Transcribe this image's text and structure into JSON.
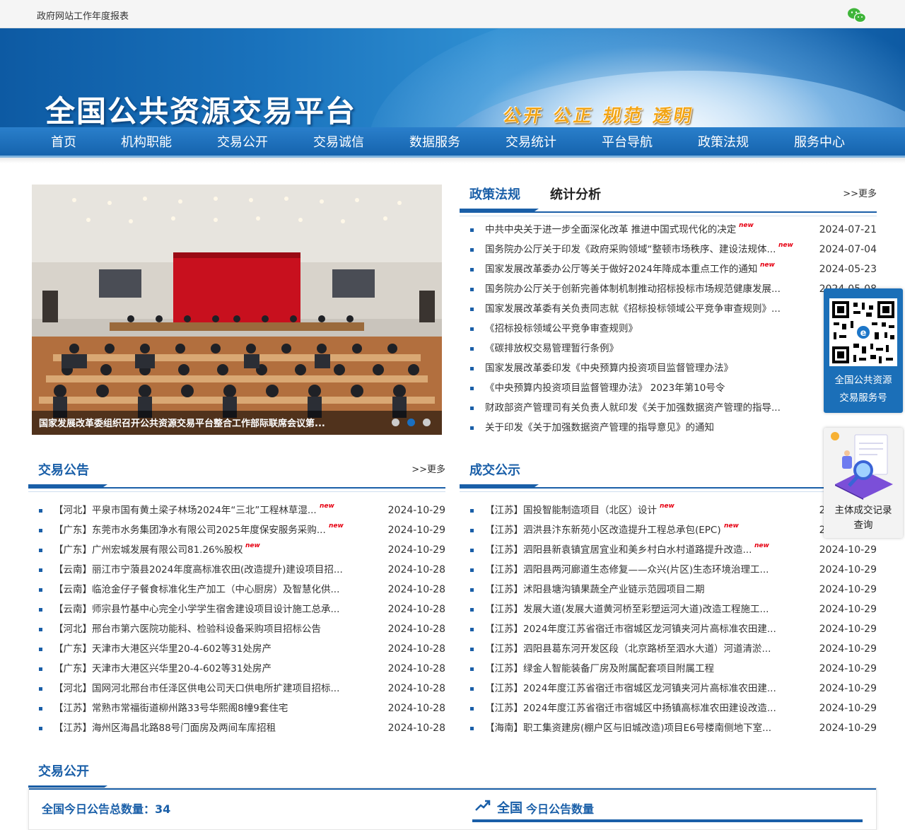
{
  "topbar": {
    "report_link": "政府网站工作年度报表",
    "wechat_icon": "wechat-icon"
  },
  "banner": {
    "title": "全国公共资源交易平台",
    "slogan": "公开 公正 规范 透明"
  },
  "nav": {
    "items": [
      "首页",
      "机构职能",
      "交易公开",
      "交易诚信",
      "数据服务",
      "交易统计",
      "平台导航",
      "政策法规",
      "服务中心"
    ]
  },
  "slider": {
    "caption": "国家发展改革委组织召开公共资源交易平台整合工作部际联席会议第...",
    "dots": 3,
    "active_dot": 2
  },
  "policy": {
    "tabs": [
      "政策法规",
      "统计分析"
    ],
    "more": ">>更多",
    "items": [
      {
        "title": "中共中央关于进一步全面深化改革 推进中国式现代化的决定",
        "date": "2024-07-21",
        "new": true
      },
      {
        "title": "国务院办公厅关于印发《政府采购领域“整顿市场秩序、建设法规体...",
        "date": "2024-07-04",
        "new": true
      },
      {
        "title": "国家发展改革委办公厅等关于做好2024年降成本重点工作的通知",
        "date": "2024-05-23",
        "new": true
      },
      {
        "title": "国务院办公厅关于创新完善体制机制推动招标投标市场规范健康发展...",
        "date": "2024-05-08",
        "new": false
      },
      {
        "title": "国家发展改革委有关负责同志就《招标投标领域公平竞争审查规则》...",
        "date": "",
        "new": false
      },
      {
        "title": "《招标投标领域公平竞争审查规则》",
        "date": "",
        "new": false
      },
      {
        "title": "《碳排放权交易管理暂行条例》",
        "date": "",
        "new": false
      },
      {
        "title": "国家发展改革委印发《中央预算内投资项目监督管理办法》",
        "date": "",
        "new": false
      },
      {
        "title": "《中央预算内投资项目监督管理办法》 2023年第10号令",
        "date": "",
        "new": false
      },
      {
        "title": "财政部资产管理司有关负责人就印发《关于加强数据资产管理的指导...",
        "date": "",
        "new": false
      },
      {
        "title": "关于印发《关于加强数据资产管理的指导意见》的通知",
        "date": "",
        "new": false
      }
    ]
  },
  "notice": {
    "title": "交易公告",
    "more": ">>更多",
    "items": [
      {
        "title": "【河北】平泉市国有黄土梁子林场2024年“三北”工程林草湿...",
        "date": "2024-10-29",
        "new": true
      },
      {
        "title": "【广东】东莞市水务集团净水有限公司2025年度保安服务采购...",
        "date": "2024-10-29",
        "new": true
      },
      {
        "title": "【广东】广州宏城发展有限公司81.26%股权",
        "date": "2024-10-29",
        "new": true
      },
      {
        "title": "【云南】丽江市宁蒗县2024年度高标准农田(改造提升)建设项目招...",
        "date": "2024-10-28",
        "new": false
      },
      {
        "title": "【云南】临沧金仔子餐食标准化生产加工（中心厨房）及智慧化供...",
        "date": "2024-10-28",
        "new": false
      },
      {
        "title": "【云南】师宗县竹基中心完全小学学生宿舍建设项目设计施工总承...",
        "date": "2024-10-28",
        "new": false
      },
      {
        "title": "【河北】邢台市第六医院功能科、检验科设备采购项目招标公告",
        "date": "2024-10-28",
        "new": false
      },
      {
        "title": "【广东】天津市大港区兴华里20-4-602等31处房产",
        "date": "2024-10-28",
        "new": false
      },
      {
        "title": "【广东】天津市大港区兴华里20-4-602等31处房产",
        "date": "2024-10-28",
        "new": false
      },
      {
        "title": "【河北】国网河北邢台市任泽区供电公司天口供电所扩建项目招标...",
        "date": "2024-10-28",
        "new": false
      },
      {
        "title": "【江苏】常熟市常福街道柳州路33号华熙阁8幢9套住宅",
        "date": "2024-10-28",
        "new": false
      },
      {
        "title": "【江苏】海州区海昌北路88号门面房及两间车库招租",
        "date": "2024-10-28",
        "new": false
      }
    ]
  },
  "deal": {
    "title": "成交公示",
    "items": [
      {
        "title": "【江苏】国投智能制造项目（北区）设计",
        "date": "2024-10-29",
        "new": true
      },
      {
        "title": "【江苏】泗洪县汴东新苑小区改造提升工程总承包(EPC)",
        "date": "2024-10-29",
        "new": true
      },
      {
        "title": "【江苏】泗阳县新袁镇宜居宜业和美乡村白水村道路提升改造...",
        "date": "2024-10-29",
        "new": true
      },
      {
        "title": "【江苏】泗阳县两河廊道生态修复——众兴(片区)生态环境治理工...",
        "date": "2024-10-29",
        "new": false
      },
      {
        "title": "【江苏】沭阳县塘沟镇果蔬全产业链示范园项目二期",
        "date": "2024-10-29",
        "new": false
      },
      {
        "title": "【江苏】发展大道(发展大道黄河桥至彩塑运河大道)改造工程施工...",
        "date": "2024-10-29",
        "new": false
      },
      {
        "title": "【江苏】2024年度江苏省宿迁市宿城区龙河镇夹河片高标准农田建...",
        "date": "2024-10-29",
        "new": false
      },
      {
        "title": "【江苏】泗阳县葛东河开发区段（北京路桥至泗水大道）河道清淤...",
        "date": "2024-10-29",
        "new": false
      },
      {
        "title": "【江苏】绿金人智能装备厂房及附属配套项目附属工程",
        "date": "2024-10-29",
        "new": false
      },
      {
        "title": "【江苏】2024年度江苏省宿迁市宿城区龙河镇夹河片高标准农田建...",
        "date": "2024-10-29",
        "new": false
      },
      {
        "title": "【江苏】2024年度江苏省宿迁市宿城区中扬镇高标准农田建设改造...",
        "date": "2024-10-29",
        "new": false
      },
      {
        "title": "【海南】职工集资建房(棚户区与旧城改造)项目E6号楼南侧地下室...",
        "date": "2024-10-29",
        "new": false
      }
    ]
  },
  "open": {
    "title": "交易公开",
    "total_label": "全国今日公告总数量：",
    "total_value": "34",
    "scope": "全国",
    "scope_sub": "今日公告数量"
  },
  "float_qr": {
    "label1": "全国公共资源",
    "label2": "交易服务号"
  },
  "float_record": {
    "label1": "主体成交记录",
    "label2": "查询"
  },
  "new_badge": "new"
}
